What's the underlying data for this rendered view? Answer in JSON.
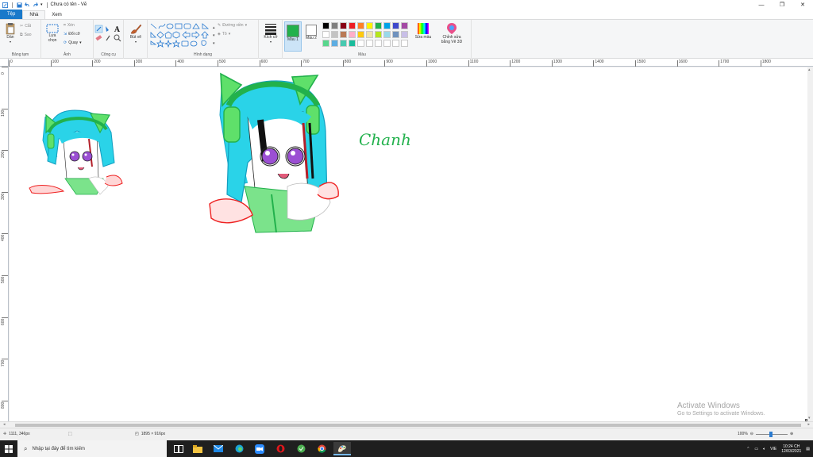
{
  "window": {
    "title": "Chưa có tên - Vẽ",
    "controls": [
      "—",
      "❐",
      "✕"
    ]
  },
  "tabs": [
    "Tệp",
    "Nhà",
    "Xem"
  ],
  "ribbon": {
    "clipboard": {
      "paste": "Dán",
      "cut": "Cắt",
      "copy": "Sao",
      "label": "Bảng tạm"
    },
    "image": {
      "select": "Lựa chọn",
      "crop": "Xén",
      "resize": "Đổi cỡ",
      "rotate": "Quay",
      "label": "Ảnh"
    },
    "tools": {
      "label": "Công cụ"
    },
    "brushes": {
      "button": "Bút vẽ"
    },
    "shapes": {
      "outline": "Đường viền",
      "fill": "Tô",
      "label": "Hình dạng"
    },
    "size": {
      "button": "Kích cỡ"
    },
    "colors": {
      "color1": "Màu 1",
      "color2": "Màu 2",
      "edit_colors": "Sửa màu",
      "edit_paint3d": "Chỉnh sửa bằng Vẽ 3D",
      "label": "Màu",
      "color1_value": "#22b14c",
      "color2_value": "#ffffff",
      "palette_row1": [
        "#000000",
        "#7f7f7f",
        "#880015",
        "#ed1c24",
        "#ff7f27",
        "#fff200",
        "#22b14c",
        "#00a2e8",
        "#3f48cc",
        "#a349a4"
      ],
      "palette_row2": [
        "#ffffff",
        "#c3c3c3",
        "#b97a57",
        "#ffaec9",
        "#ffc90e",
        "#efe4b0",
        "#b5e61d",
        "#99d9ea",
        "#7092be",
        "#c8bfe7"
      ],
      "palette_row3": [
        "#58d68d",
        "#5dade2",
        "#48c9b0",
        "#1abc9c",
        "#ffffff",
        "#ffffff",
        "#ffffff",
        "#ffffff",
        "#ffffff",
        "#ffffff"
      ]
    }
  },
  "rulers": {
    "top": [
      "0",
      "100",
      "200",
      "300",
      "400",
      "500",
      "600",
      "700",
      "800",
      "900",
      "1000",
      "1100",
      "1200",
      "1300",
      "1400",
      "1500",
      "1600",
      "1700",
      "1800"
    ],
    "left": [
      "0",
      "100",
      "200",
      "300",
      "400",
      "500",
      "600",
      "700",
      "800"
    ]
  },
  "canvas": {
    "handwriting": "Chanh"
  },
  "status": {
    "cursor": "1111, 346px",
    "canvas_size": "1895 × 916px",
    "zoom": "100%"
  },
  "watermark": {
    "title": "Activate Windows",
    "subtitle": "Go to Settings to activate Windows."
  },
  "taskbar": {
    "search_placeholder": "Nhập tại đây để tìm kiếm",
    "lang": "VIE",
    "time": "10:24 CH",
    "date": "12/03/2021"
  }
}
